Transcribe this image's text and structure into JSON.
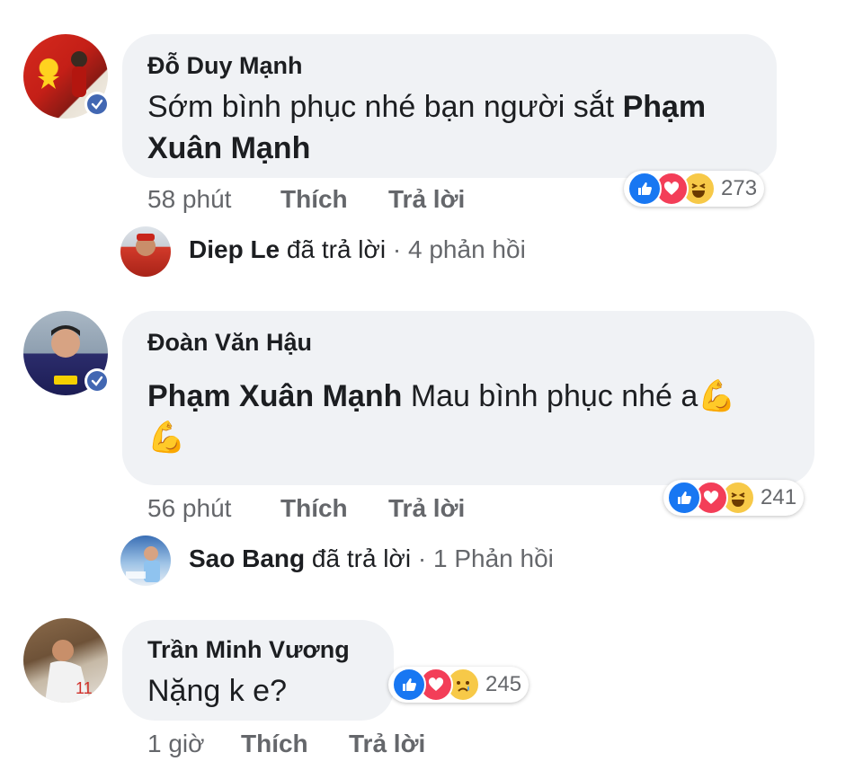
{
  "comments": [
    {
      "author": "Đỗ Duy Mạnh",
      "text_plain": "Sớm bình phục nhé bạn người sắt",
      "text_bold": "Phạm Xuân Mạnh",
      "time": "58 phút",
      "like": "Thích",
      "reply": "Trả lời",
      "reactions": [
        "like",
        "love",
        "haha"
      ],
      "reaction_count": "273",
      "reply_summary": {
        "name": "Diep Le",
        "action": "đã trả lời",
        "sep": "·",
        "count": "4 phản hồi"
      }
    },
    {
      "author": "Đoàn Văn Hậu",
      "text_bold": "Phạm Xuân Mạnh",
      "text_plain": "Mau bình phục nhé a",
      "emoji": "💪",
      "time": "56 phút",
      "like": "Thích",
      "reply": "Trả lời",
      "reactions": [
        "like",
        "love",
        "haha"
      ],
      "reaction_count": "241",
      "reply_summary": {
        "name": "Sao Bang",
        "action": "đã trả lời",
        "sep": "·",
        "count": "1 Phản hồi"
      }
    },
    {
      "author": "Trần Minh Vương",
      "text_plain": "Nặng k e?",
      "time": "1 giờ",
      "like": "Thích",
      "reply": "Trả lời",
      "reactions": [
        "like",
        "love",
        "sad"
      ],
      "reaction_count": "245"
    }
  ],
  "colors": {
    "bubble": "#f0f2f5",
    "meta_gray": "#65676b",
    "like_blue": "#1877f2",
    "love_red": "#f33e58",
    "emoji_yellow": "#f7c948",
    "verified_blue": "#4267b2"
  },
  "icons": [
    "verified-badge-icon",
    "like-reaction-icon",
    "love-reaction-icon",
    "haha-reaction-icon",
    "sad-reaction-icon",
    "flexed-biceps-emoji"
  ]
}
